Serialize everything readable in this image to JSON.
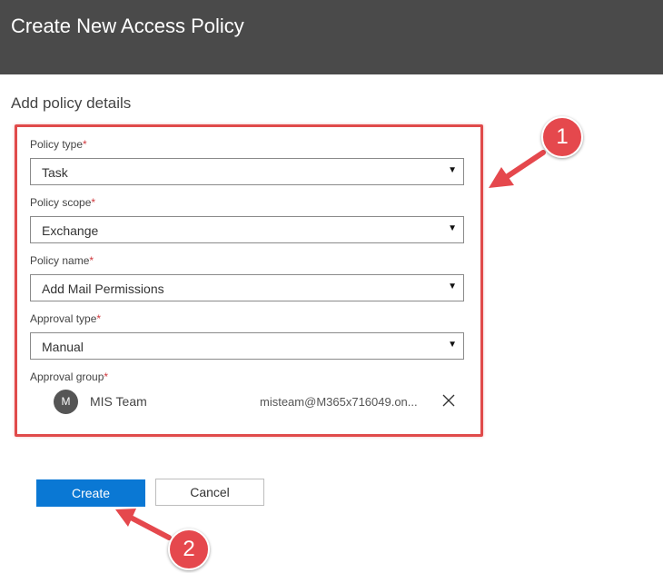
{
  "header": {
    "title": "Create New Access Policy"
  },
  "section": {
    "title": "Add policy details"
  },
  "fields": {
    "policy_type": {
      "label": "Policy type",
      "required_mark": "*",
      "value": "Task"
    },
    "policy_scope": {
      "label": "Policy scope",
      "required_mark": "*",
      "value": "Exchange"
    },
    "policy_name": {
      "label": "Policy name",
      "required_mark": "*",
      "value": "Add Mail Permissions"
    },
    "approval_type": {
      "label": "Approval type",
      "required_mark": "*",
      "value": "Manual"
    },
    "approval_group": {
      "label": "Approval group",
      "required_mark": "*"
    }
  },
  "approver": {
    "initial": "M",
    "name": "MIS Team",
    "email": "misteam@M365x716049.on..."
  },
  "icons": {
    "caret": "caret-down-icon",
    "remove": "close-icon"
  },
  "buttons": {
    "create": "Create",
    "cancel": "Cancel"
  },
  "annotations": {
    "step1": "1",
    "step2": "2"
  },
  "colors": {
    "header_bg": "#4a4a4a",
    "accent": "#0a78d4",
    "highlight": "#e04a4a",
    "required": "#d0393e"
  }
}
